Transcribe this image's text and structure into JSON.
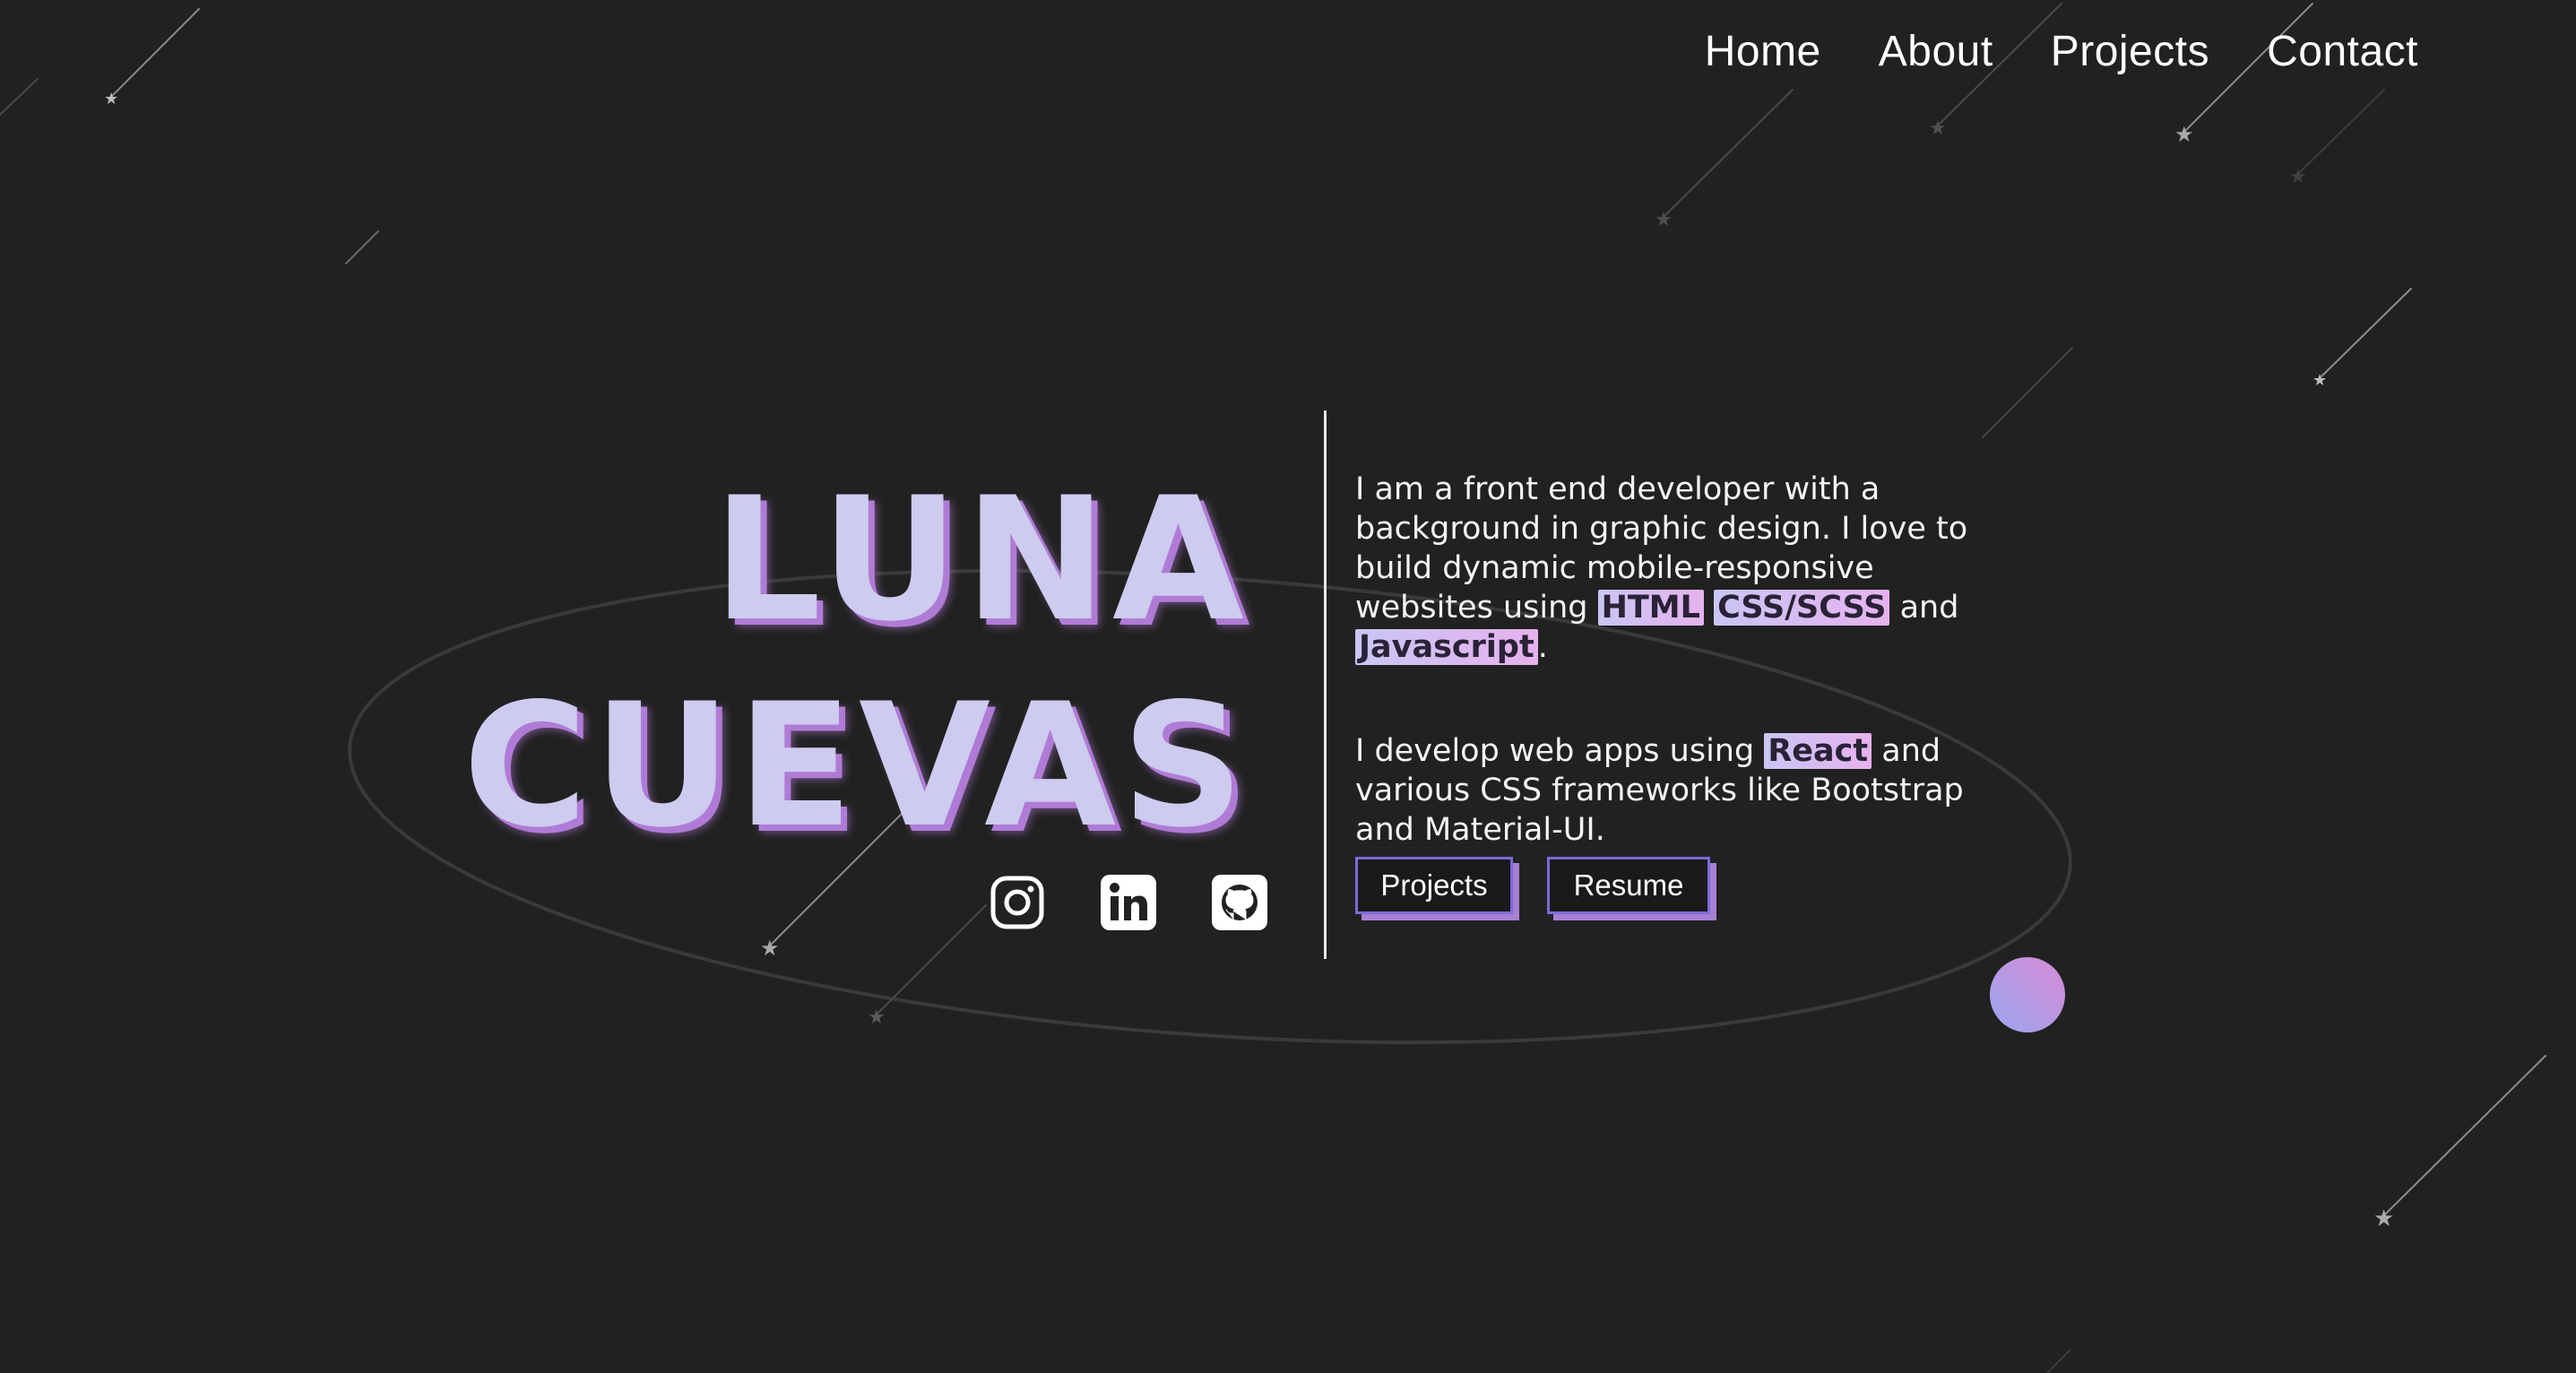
{
  "nav": {
    "items": [
      {
        "label": "Home"
      },
      {
        "label": "About"
      },
      {
        "label": "Projects"
      },
      {
        "label": "Contact"
      }
    ]
  },
  "hero": {
    "first_name": "LUNA",
    "last_name": "CUEVAS"
  },
  "socials": [
    {
      "icon": "instagram-icon"
    },
    {
      "icon": "linkedin-icon"
    },
    {
      "icon": "github-icon"
    }
  ],
  "bio": {
    "p1_a": "I am a front end developer with a background in graphic design. I love to build dynamic mobile-responsive websites using ",
    "p1_tag1": "HTML",
    "p1_tag2": "CSS/SCSS",
    "p1_and": " and ",
    "p1_tag3": "Javascript",
    "p1_end": ".",
    "p2_a": "I develop web apps using ",
    "p2_tag": "React",
    "p2_b": " and various CSS frameworks like Bootstrap and Material-UI."
  },
  "actions": {
    "projects_label": "Projects",
    "resume_label": "Resume"
  },
  "colors": {
    "background": "#212121",
    "name_fill": "#cdcbee",
    "name_shadow": "#b07bd6",
    "button_border": "#7a6bd8",
    "button_shadow": "#a77fd4",
    "planet_gradient_start": "#9aa6ee",
    "planet_gradient_end": "#d88ad6"
  }
}
